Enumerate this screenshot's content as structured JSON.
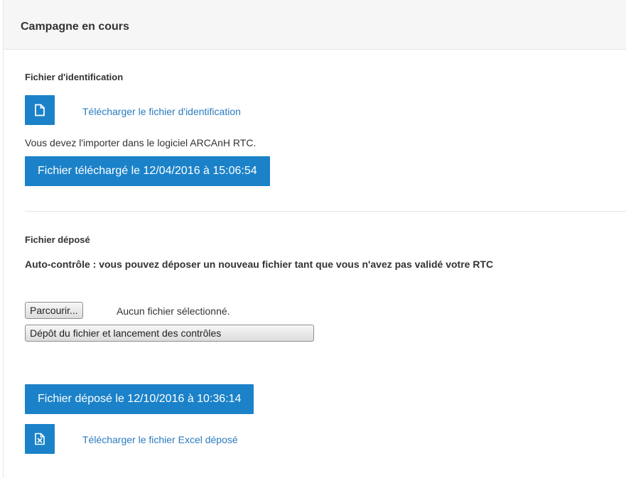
{
  "panel": {
    "title": "Campagne en cours"
  },
  "identification": {
    "section_title": "Fichier d'identification",
    "download_icon": "file-icon",
    "download_link": "Télécharger le fichier d'identification",
    "instruction": "Vous devez l'importer dans le logiciel ARCAnH RTC.",
    "downloaded_button": "Fichier téléchargé le 12/04/2016 à 15:06:54"
  },
  "deposit": {
    "section_title": "Fichier déposé",
    "notice": "Auto-contrôle : vous pouvez déposer un nouveau fichier tant que vous n'avez pas validé votre RTC",
    "browse_button": "Parcourir...",
    "file_status": "Aucun fichier sélectionné.",
    "submit_button": "Dépôt du fichier et lancement des contrôles",
    "deposited_button": "Fichier déposé le 12/10/2016 à 10:36:14",
    "excel_icon": "excel-file-icon",
    "excel_link": "Télécharger le fichier Excel déposé"
  },
  "colors": {
    "primary": "#1b82c9",
    "link": "#2a7bbf",
    "text": "#333333",
    "header_bg": "#f6f6f6"
  }
}
